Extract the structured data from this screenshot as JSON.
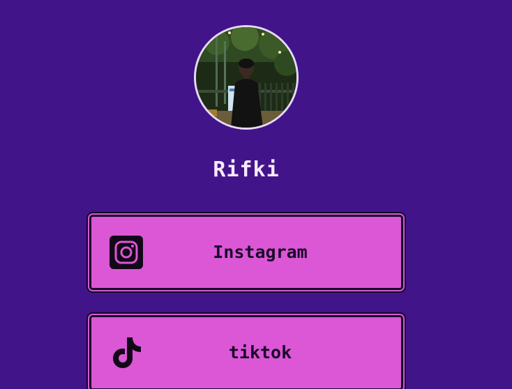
{
  "profile": {
    "name": "Rifki",
    "avatar_icon": "profile-photo"
  },
  "links": [
    {
      "label": "Instagram",
      "icon": "instagram-icon"
    },
    {
      "label": "tiktok",
      "icon": "tiktok-icon"
    }
  ],
  "colors": {
    "background": "#42148a",
    "button": "#db57d6",
    "button_border": "#16082a",
    "name_text": "#f7eafc",
    "button_text": "#1a0a2a"
  }
}
